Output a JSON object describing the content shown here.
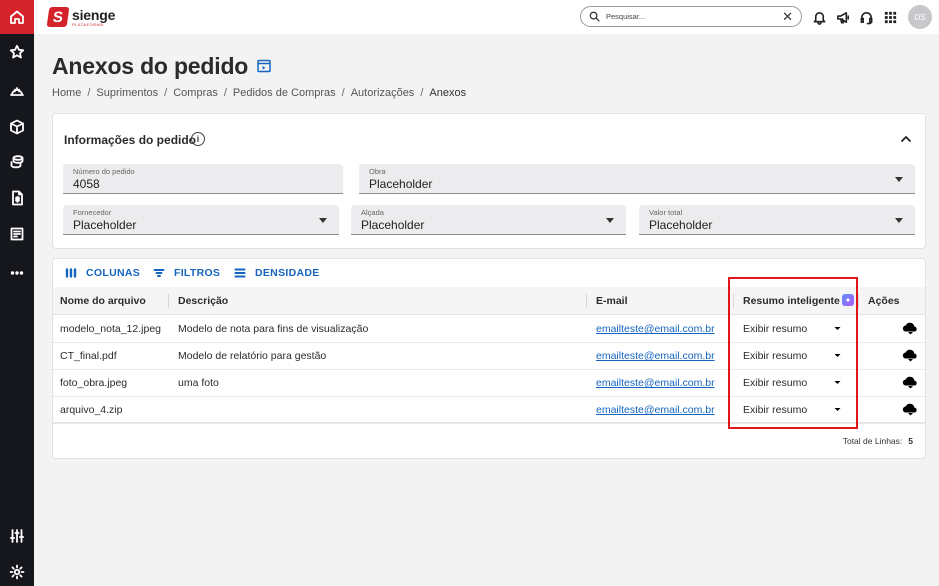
{
  "app": {
    "logo_name": "sienge",
    "logo_sub": "PLATAFORMA",
    "brand_color": "#d4232b"
  },
  "rail": {
    "items": [
      {
        "icon": "home-icon",
        "active": true
      },
      {
        "icon": "star-icon"
      },
      {
        "icon": "helmet-icon"
      },
      {
        "icon": "box-icon"
      },
      {
        "icon": "coins-icon"
      },
      {
        "icon": "document-money-icon"
      },
      {
        "icon": "invoice-icon"
      },
      {
        "icon": "more-icon"
      },
      {
        "icon": "sliders-icon"
      },
      {
        "icon": "settings-icon"
      }
    ]
  },
  "search": {
    "placeholder": "Pesquisar..."
  },
  "user": {
    "initials": "DS"
  },
  "page": {
    "title": "Anexos do pedido",
    "breadcrumb": [
      "Home",
      "Suprimentos",
      "Compras",
      "Pedidos de Compras",
      "Autorizações",
      "Anexos"
    ]
  },
  "info_panel": {
    "title": "Informações do pedido",
    "fields": {
      "numero": {
        "label": "Número do pedido",
        "value": "4058"
      },
      "obra": {
        "label": "Obra",
        "value": "Placeholder"
      },
      "fornecedor": {
        "label": "Fornecedor",
        "value": "Placeholder"
      },
      "alcada": {
        "label": "Alçada",
        "value": "Placeholder"
      },
      "valor_total": {
        "label": "Valor total",
        "value": "Placeholder"
      }
    }
  },
  "toolbar": {
    "columns_label": "COLUNAS",
    "filters_label": "FILTROS",
    "density_label": "DENSIDADE"
  },
  "table": {
    "headers": {
      "file": "Nome do arquivo",
      "description": "Descrição",
      "email": "E-mail",
      "summary": "Resumo inteligente",
      "actions": "Ações"
    },
    "rows": [
      {
        "file": "modelo_nota_12.jpeg",
        "description": "Modelo de nota para fins de visualização",
        "email": "emailteste@email.com.br",
        "summary": "Exibir resumo"
      },
      {
        "file": "CT_final.pdf",
        "description": "Modelo de relatório para gestão",
        "email": "emailteste@email.com.br",
        "summary": "Exibir resumo"
      },
      {
        "file": "foto_obra.jpeg",
        "description": "uma foto",
        "email": "emailteste@email.com.br",
        "summary": "Exibir resumo"
      },
      {
        "file": "arquivo_4.zip",
        "description": "",
        "email": "emailteste@email.com.br",
        "summary": "Exibir resumo"
      }
    ],
    "total_label": "Total de Linhas:",
    "total_value": "5"
  }
}
